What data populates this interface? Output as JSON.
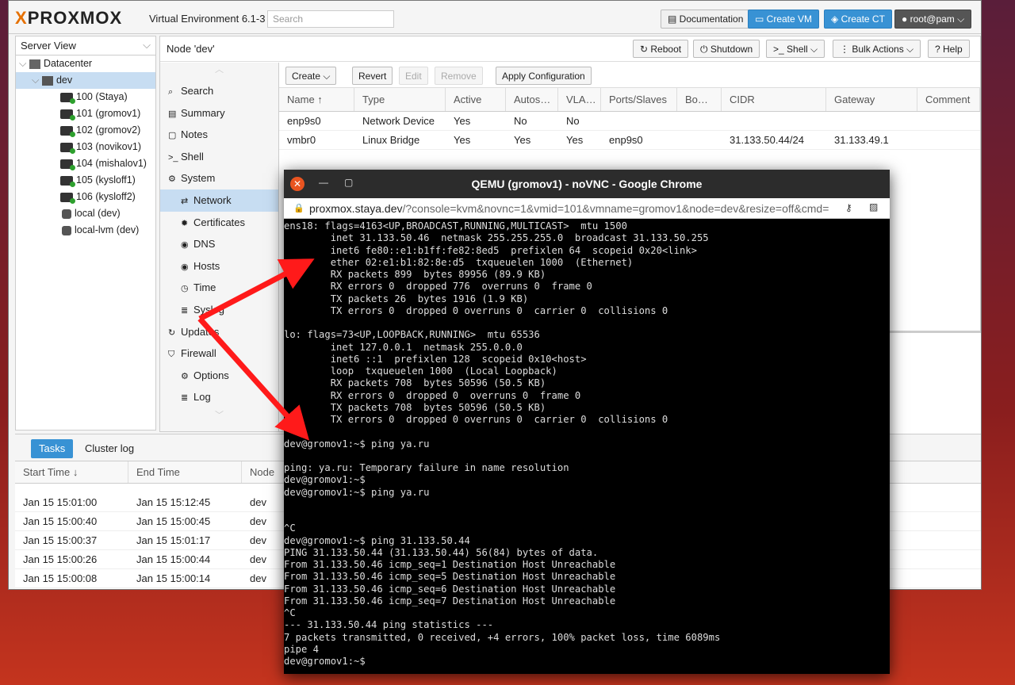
{
  "pve": {
    "logo": "PROXMOX",
    "version": "Virtual Environment 6.1-3",
    "search_placeholder": "Search",
    "buttons": {
      "documentation": "Documentation",
      "create_vm": "Create VM",
      "create_ct": "Create CT",
      "user": "root@pam"
    },
    "sidebar": {
      "view": "Server View",
      "datacenter": "Datacenter",
      "node": "dev",
      "items": [
        "100 (Staya)",
        "101 (gromov1)",
        "102 (gromov2)",
        "103 (novikov1)",
        "104 (mishalov1)",
        "105 (kysloff1)",
        "106 (kysloff2)"
      ],
      "storage": [
        "local (dev)",
        "local-lvm (dev)"
      ]
    },
    "node_header": {
      "title": "Node 'dev'",
      "reboot": "Reboot",
      "shutdown": "Shutdown",
      "shell": "Shell",
      "bulk": "Bulk Actions",
      "help": "Help"
    },
    "node_menu": [
      "Search",
      "Summary",
      "Notes",
      "Shell",
      "System",
      "Network",
      "Certificates",
      "DNS",
      "Hosts",
      "Time",
      "Syslog",
      "Updates",
      "Firewall",
      "Options",
      "Log"
    ],
    "net_toolbar": {
      "create": "Create",
      "revert": "Revert",
      "edit": "Edit",
      "remove": "Remove",
      "apply": "Apply Configuration"
    },
    "net_columns": [
      "Name ↑",
      "Type",
      "Active",
      "Autos…",
      "VLA…",
      "Ports/Slaves",
      "Bo…",
      "CIDR",
      "Gateway",
      "Comment"
    ],
    "net_rows": [
      [
        "enp9s0",
        "Network Device",
        "Yes",
        "No",
        "No",
        "",
        "",
        "",
        "",
        ""
      ],
      [
        "vmbr0",
        "Linux Bridge",
        "Yes",
        "Yes",
        "Yes",
        "enp9s0",
        "",
        "31.133.50.44/24",
        "31.133.49.1",
        ""
      ]
    ],
    "tasks": {
      "tab_tasks": "Tasks",
      "tab_cluster": "Cluster log",
      "columns": [
        "Start Time ↓",
        "End Time",
        "Node"
      ],
      "rows": [
        [
          "Jan 15 15:01:00",
          "Jan 15 15:12:45",
          "dev"
        ],
        [
          "Jan 15 15:00:40",
          "Jan 15 15:00:45",
          "dev"
        ],
        [
          "Jan 15 15:00:37",
          "Jan 15 15:01:17",
          "dev"
        ],
        [
          "Jan 15 15:00:26",
          "Jan 15 15:00:44",
          "dev"
        ],
        [
          "Jan 15 15:00:08",
          "Jan 15 15:00:14",
          "dev"
        ]
      ]
    }
  },
  "chrome": {
    "title": "QEMU (gromov1) - noVNC - Google Chrome",
    "url_host": "proxmox.staya.dev",
    "url_rest": "/?console=kvm&novnc=1&vmid=101&vmname=gromov1&node=dev&resize=off&cmd=",
    "terminal": "ens18: flags=4163<UP,BROADCAST,RUNNING,MULTICAST>  mtu 1500\n        inet 31.133.50.46  netmask 255.255.255.0  broadcast 31.133.50.255\n        inet6 fe80::e1:b1ff:fe82:8ed5  prefixlen 64  scopeid 0x20<link>\n        ether 02:e1:b1:82:8e:d5  txqueuelen 1000  (Ethernet)\n        RX packets 899  bytes 89956 (89.9 KB)\n        RX errors 0  dropped 776  overruns 0  frame 0\n        TX packets 26  bytes 1916 (1.9 KB)\n        TX errors 0  dropped 0 overruns 0  carrier 0  collisions 0\n\nlo: flags=73<UP,LOOPBACK,RUNNING>  mtu 65536\n        inet 127.0.0.1  netmask 255.0.0.0\n        inet6 ::1  prefixlen 128  scopeid 0x10<host>\n        loop  txqueuelen 1000  (Local Loopback)\n        RX packets 708  bytes 50596 (50.5 KB)\n        RX errors 0  dropped 0  overruns 0  frame 0\n        TX packets 708  bytes 50596 (50.5 KB)\n        TX errors 0  dropped 0 overruns 0  carrier 0  collisions 0\n\ndev@gromov1:~$ ping ya.ru\n\nping: ya.ru: Temporary failure in name resolution\ndev@gromov1:~$\ndev@gromov1:~$ ping ya.ru\n\n\n^C\ndev@gromov1:~$ ping 31.133.50.44\nPING 31.133.50.44 (31.133.50.44) 56(84) bytes of data.\nFrom 31.133.50.46 icmp_seq=1 Destination Host Unreachable\nFrom 31.133.50.46 icmp_seq=5 Destination Host Unreachable\nFrom 31.133.50.46 icmp_seq=6 Destination Host Unreachable\nFrom 31.133.50.46 icmp_seq=7 Destination Host Unreachable\n^C\n--- 31.133.50.44 ping statistics ---\n7 packets transmitted, 0 received, +4 errors, 100% packet loss, time 6089ms\npipe 4\ndev@gromov1:~$"
  },
  "annotation": {
    "arrow_color": "#ff1a1a"
  }
}
